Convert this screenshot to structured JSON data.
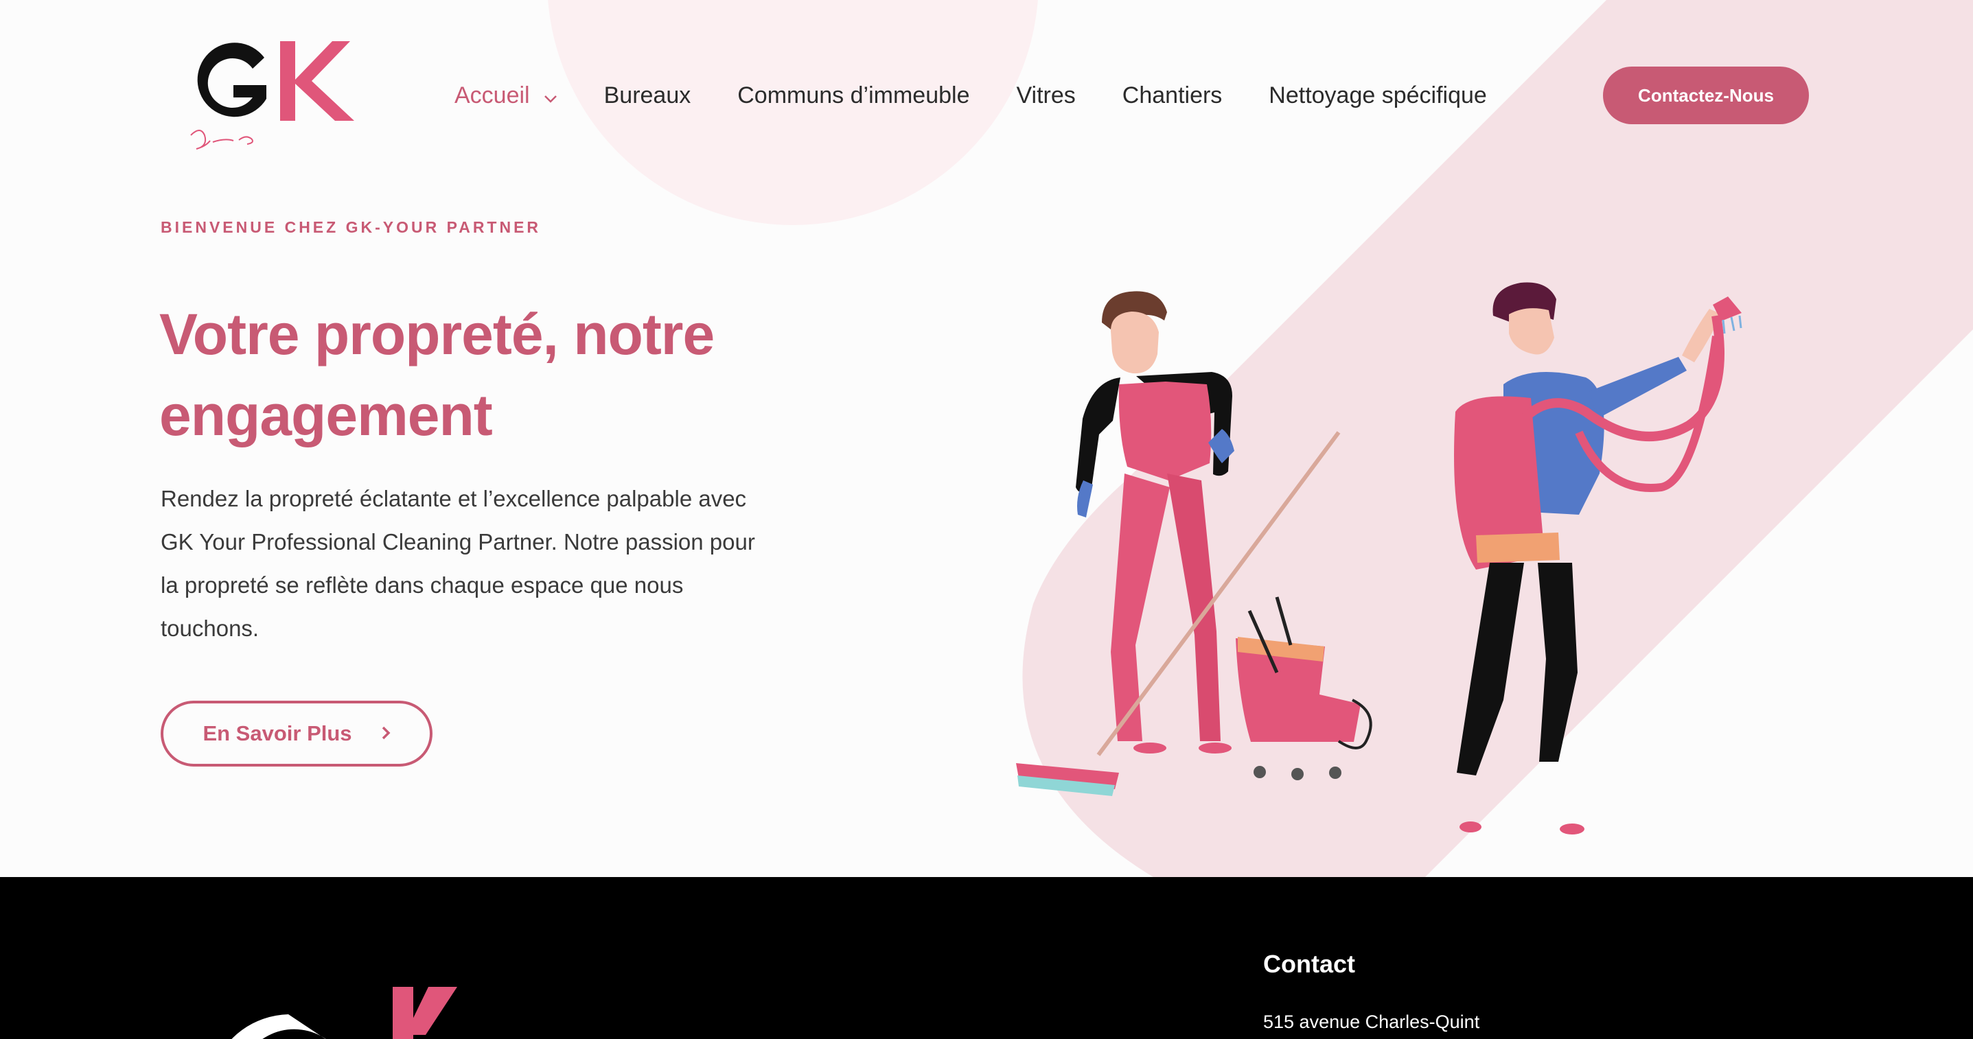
{
  "brand": {
    "logo_letters": "GK",
    "logo_script": "Your Partner",
    "colors": {
      "accent": "#c85a74",
      "dark": "#111111",
      "blush": "#f5e1e5",
      "footer": "#000000"
    }
  },
  "nav": {
    "items": [
      {
        "label": "Accueil",
        "active": true,
        "has_dropdown": true
      },
      {
        "label": "Bureaux"
      },
      {
        "label": "Communs d’immeuble"
      },
      {
        "label": "Vitres"
      },
      {
        "label": "Chantiers"
      },
      {
        "label": "Nettoyage spécifique"
      }
    ],
    "cta_label": "Contactez-Nous"
  },
  "hero": {
    "eyebrow": "BIENVENUE CHEZ GK-YOUR PARTNER",
    "headline_line1": "Votre propreté, notre",
    "headline_line2": "engagement",
    "description": "Rendez la propreté éclatante et l’excellence palpable avec GK Your Professional Cleaning Partner. Notre passion pour la propreté se reflète dans chaque espace que nous touchons.",
    "button_label": "En Savoir Plus",
    "illustration": "two-cleaners-illustration"
  },
  "footer": {
    "contact_title": "Contact",
    "address": "515 avenue Charles-Quint"
  },
  "icons": [
    "chevron-down-icon",
    "chevron-right-icon"
  ]
}
